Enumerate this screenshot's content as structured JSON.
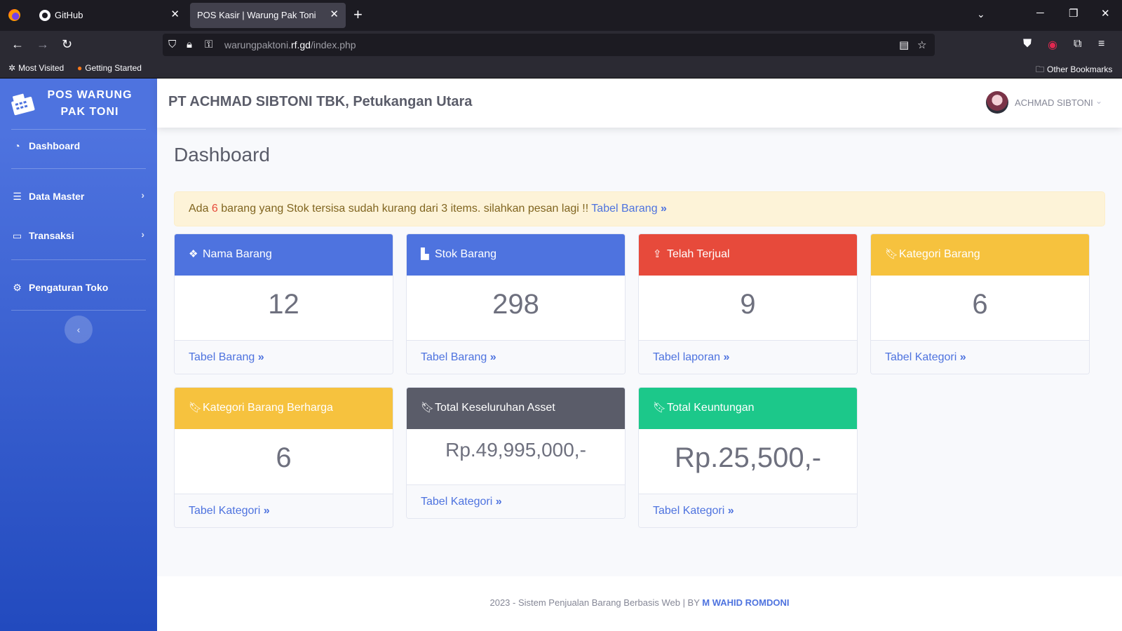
{
  "browser": {
    "tabs": [
      {
        "label": "GitHub",
        "active": false
      },
      {
        "label": "POS Kasir | Warung Pak Toni",
        "active": true
      }
    ],
    "url_prefix": "warungpaktoni.",
    "url_domain": "rf.gd",
    "url_path": "/index.php",
    "bookmarks": [
      "Most Visited",
      "Getting Started"
    ],
    "other_bookmarks": "Other Bookmarks"
  },
  "sidebar": {
    "brand_line1": "POS WARUNG",
    "brand_line2": "PAK TONI",
    "items": [
      {
        "label": "Dashboard",
        "icon": "gauge-icon"
      },
      {
        "label": "Data Master",
        "icon": "database-icon"
      },
      {
        "label": "Transaksi",
        "icon": "desktop-icon"
      },
      {
        "label": "Pengaturan Toko",
        "icon": "cogs-icon"
      }
    ],
    "toggle": "‹"
  },
  "topbar": {
    "company": "PT ACHMAD SIBTONI TBK, Petukangan Utara",
    "user_name": "ACHMAD SIBTONI"
  },
  "main": {
    "page_title": "Dashboard",
    "alert": {
      "prefix": "Ada ",
      "count": "6",
      "message": " barang yang Stok tersisa sudah kurang dari 3 items. silahkan pesan lagi !! ",
      "link": "Tabel Barang"
    },
    "cards": [
      {
        "title": "Nama Barang",
        "value": "12",
        "link": "Tabel Barang",
        "color": "#4e73df",
        "icon": "cubes-icon"
      },
      {
        "title": "Stok Barang",
        "value": "298",
        "link": "Tabel Barang",
        "color": "#4e73df",
        "icon": "chart-bar-icon"
      },
      {
        "title": "Telah Terjual",
        "value": "9",
        "link": "Tabel laporan",
        "color": "#e74a3b",
        "icon": "upload-icon"
      },
      {
        "title": "Kategori Barang",
        "value": "6",
        "link": "Tabel Kategori",
        "color": "#f6c23e",
        "icon": "bookmark-icon"
      },
      {
        "title": "Kategori Barang Berharga",
        "value": "6",
        "link": "Tabel Kategori",
        "color": "#f6c23e",
        "icon": "bookmark-icon"
      },
      {
        "title": "Total Keseluruhan Asset",
        "value": "Rp.49,995,000,-",
        "link": "Tabel Kategori",
        "color": "#5a5c69",
        "icon": "bookmark-icon"
      },
      {
        "title": "Total Keuntungan",
        "value": "Rp.25,500,-",
        "link": "Tabel Kategori",
        "color": "#1cc88a",
        "icon": "bookmark-icon"
      }
    ]
  },
  "footer": {
    "text": "2023 - Sistem Penjualan Barang Berbasis Web | BY ",
    "author": "M WAHID ROMDONI"
  }
}
